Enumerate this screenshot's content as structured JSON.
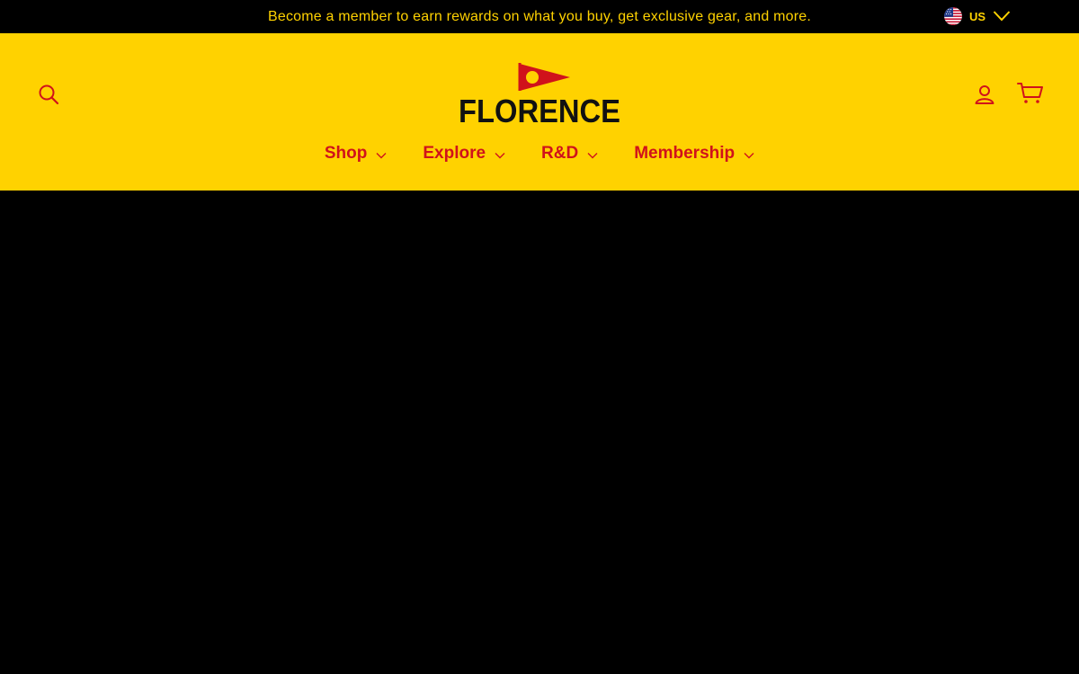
{
  "announcement": {
    "text": "Become a member to earn rewards on what you buy, get exclusive gear, and more."
  },
  "locale": {
    "country_code": "US",
    "flag_icon": "us-flag-icon"
  },
  "header": {
    "logo_text": "FLORENCE",
    "icons": [
      "search-icon",
      "account-icon",
      "cart-icon"
    ]
  },
  "nav": {
    "items": [
      {
        "label": "Shop"
      },
      {
        "label": "Explore"
      },
      {
        "label": "R&D"
      },
      {
        "label": "Membership"
      }
    ]
  },
  "colors": {
    "announcement_bg": "#000000",
    "announcement_text": "#ffd200",
    "header_bg": "#ffd200",
    "brand_red": "#d0121b",
    "icon_color": "#d0121b",
    "logo_text": "#111111",
    "page_bg": "#000000"
  }
}
